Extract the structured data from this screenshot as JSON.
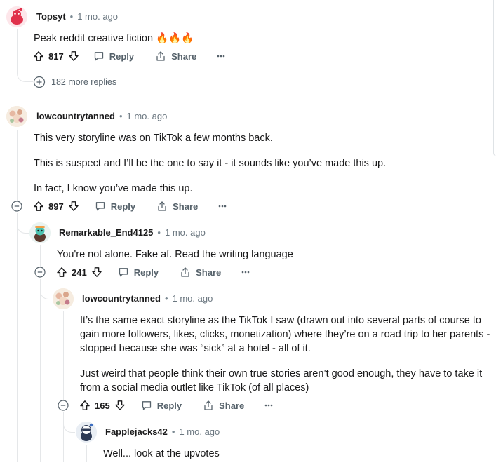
{
  "comments": [
    {
      "author": "Topsyt",
      "time": "1 mo. ago",
      "body": [
        "Peak reddit creative fiction 🔥🔥🔥"
      ],
      "votes": "817",
      "reply_label": "Reply",
      "share_label": "Share",
      "more_replies": "182 more replies"
    },
    {
      "author": "lowcountrytanned",
      "time": "1 mo. ago",
      "body": [
        "This very storyline was on TikTok a few months back.",
        "This is suspect and I’ll be the one to say it - it sounds like you’ve made this up.",
        "In fact, I know you’ve made this up."
      ],
      "votes": "897",
      "reply_label": "Reply",
      "share_label": "Share"
    },
    {
      "author": "Remarkable_End4125",
      "time": "1 mo. ago",
      "body": [
        "You're not alone. Fake af. Read the writing language"
      ],
      "votes": "241",
      "reply_label": "Reply",
      "share_label": "Share"
    },
    {
      "author": "lowcountrytanned",
      "time": "1 mo. ago",
      "body": [
        "It’s the same exact storyline as the TikTok I saw (drawn out into several parts of course to gain more followers, likes, clicks, monetization) where they’re on a road trip to her parents - stopped because she was “sick” at a hotel - all of it.",
        "Just weird that people think their own true stories aren’t good enough, they have to take it from a social media outlet like TikTok (of all places)"
      ],
      "votes": "165",
      "reply_label": "Reply",
      "share_label": "Share"
    },
    {
      "author": "Fapplejacks42",
      "time": "1 mo. ago",
      "body": [
        "Well... look at the upvotes"
      ]
    }
  ],
  "icons": {
    "upvote": "upvote-icon",
    "downvote": "downvote-icon",
    "reply": "comment-bubble-icon",
    "share": "share-icon",
    "more": "overflow-menu-icon",
    "collapse": "collapse-minus-icon",
    "expand": "expand-plus-icon"
  },
  "colors": {
    "text": "#1a1a1b",
    "meta": "#6b7780",
    "action": "#56626b",
    "thread_line": "#e5e7e9"
  }
}
